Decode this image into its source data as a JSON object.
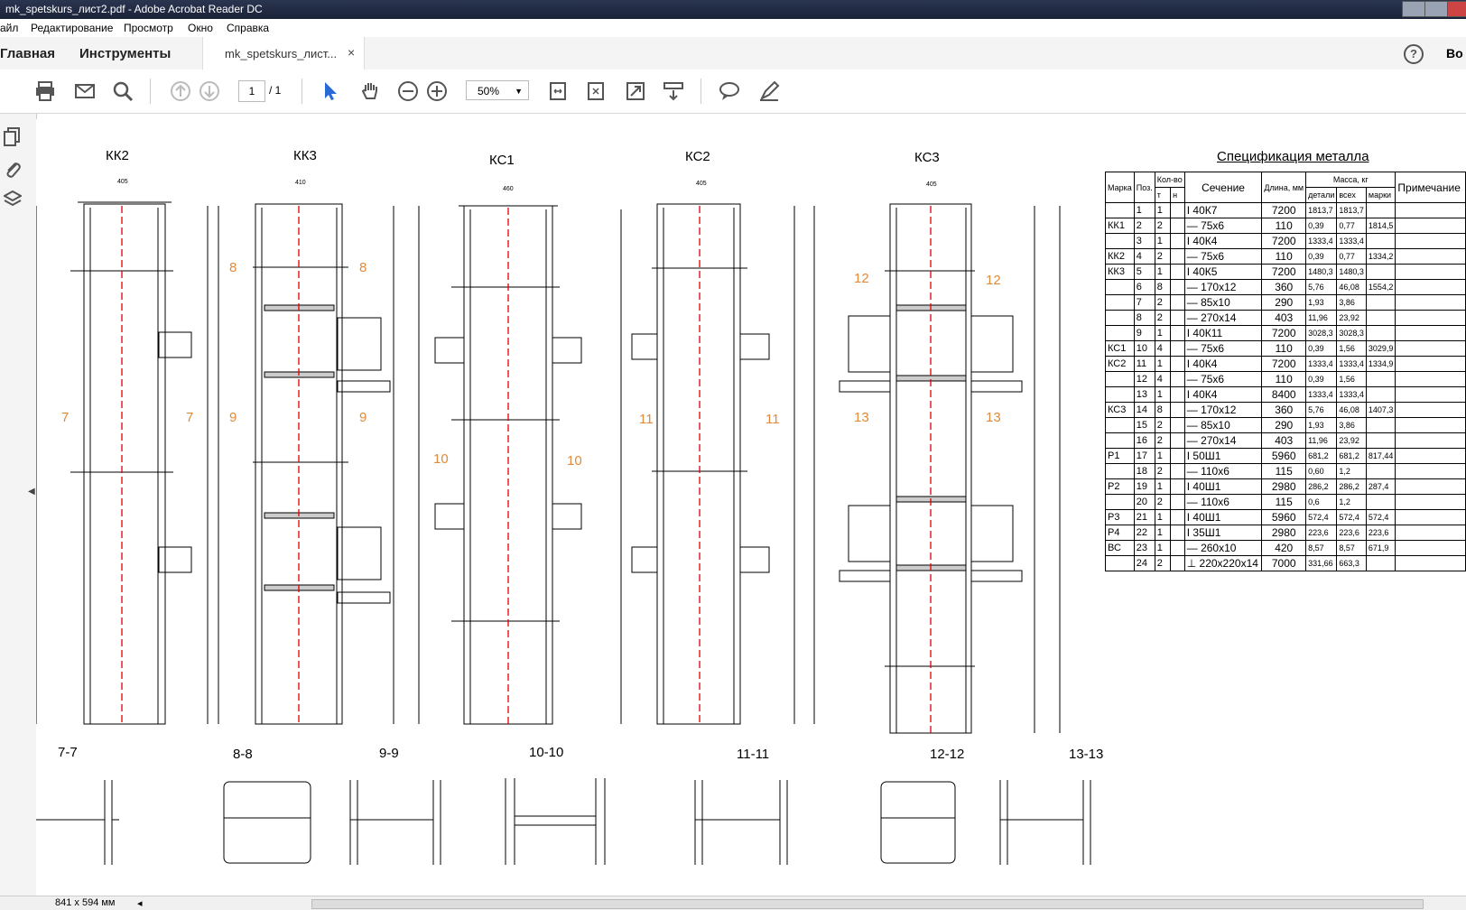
{
  "window": {
    "title": "mk_spetskurs_лист2.pdf - Adobe Acrobat Reader DC"
  },
  "menu": [
    "айл",
    "Редактирование",
    "Просмотр",
    "Окно",
    "Справка"
  ],
  "tabs": {
    "home": "Главная",
    "tools": "Инструменты",
    "doc": "mk_spetskurs_лист...",
    "close": "×",
    "help": "?",
    "right": "Во"
  },
  "toolbar": {
    "page_current": "1",
    "page_total": "/ 1",
    "zoom": "50%"
  },
  "status": {
    "size": "841 x 594 мм"
  },
  "drawing": {
    "columns": [
      {
        "name": "КК2",
        "w": "405"
      },
      {
        "name": "КК3",
        "w": "410"
      },
      {
        "name": "КС1",
        "w": "460"
      },
      {
        "name": "КС2",
        "w": "405"
      },
      {
        "name": "КС3",
        "w": "405"
      }
    ],
    "sections": [
      "7-7",
      "8-8",
      "9-9",
      "10-10",
      "11-11",
      "12-12",
      "13-13"
    ],
    "cut_marks": [
      "7",
      "8",
      "9",
      "10",
      "11",
      "12",
      "13"
    ]
  },
  "spec": {
    "title": "Спецификация металла",
    "headers": {
      "mark": "Марка",
      "pos": "Поз.",
      "qty": "Кол-во",
      "t": "т",
      "n": "н",
      "section": "Сечение",
      "length": "Длина, мм",
      "mass": "Масса, кг",
      "part": "детали",
      "all": "всех",
      "marks": "марки",
      "note": "Примечание"
    },
    "rows": [
      {
        "mark": "",
        "pos": "1",
        "q": "1",
        "sec": "I 40К7",
        "len": "7200",
        "p": "1813,7",
        "a": "1813,7",
        "m": ""
      },
      {
        "mark": "КК1",
        "pos": "2",
        "q": "2",
        "sec": "— 75x6",
        "len": "110",
        "p": "0,39",
        "a": "0,77",
        "m": "1814,5"
      },
      {
        "mark": "",
        "pos": "3",
        "q": "1",
        "sec": "I 40К4",
        "len": "7200",
        "p": "1333,4",
        "a": "1333,4",
        "m": ""
      },
      {
        "mark": "КК2",
        "pos": "4",
        "q": "2",
        "sec": "— 75x6",
        "len": "110",
        "p": "0,39",
        "a": "0,77",
        "m": "1334,2"
      },
      {
        "mark": "КК3",
        "pos": "5",
        "q": "1",
        "sec": "I 40К5",
        "len": "7200",
        "p": "1480,3",
        "a": "1480,3",
        "m": ""
      },
      {
        "mark": "",
        "pos": "6",
        "q": "8",
        "sec": "— 170x12",
        "len": "360",
        "p": "5,76",
        "a": "46,08",
        "m": "1554,2"
      },
      {
        "mark": "",
        "pos": "7",
        "q": "2",
        "sec": "— 85x10",
        "len": "290",
        "p": "1,93",
        "a": "3,86",
        "m": ""
      },
      {
        "mark": "",
        "pos": "8",
        "q": "2",
        "sec": "— 270x14",
        "len": "403",
        "p": "11,96",
        "a": "23,92",
        "m": ""
      },
      {
        "mark": "",
        "pos": "9",
        "q": "1",
        "sec": "I 40К11",
        "len": "7200",
        "p": "3028,3",
        "a": "3028,3",
        "m": ""
      },
      {
        "mark": "КС1",
        "pos": "10",
        "q": "4",
        "sec": "— 75x6",
        "len": "110",
        "p": "0,39",
        "a": "1,56",
        "m": "3029,9"
      },
      {
        "mark": "КС2",
        "pos": "11",
        "q": "1",
        "sec": "I 40К4",
        "len": "7200",
        "p": "1333,4",
        "a": "1333,4",
        "m": "1334,9"
      },
      {
        "mark": "",
        "pos": "12",
        "q": "4",
        "sec": "— 75x6",
        "len": "110",
        "p": "0,39",
        "a": "1,56",
        "m": ""
      },
      {
        "mark": "",
        "pos": "13",
        "q": "1",
        "sec": "I 40К4",
        "len": "8400",
        "p": "1333,4",
        "a": "1333,4",
        "m": ""
      },
      {
        "mark": "КС3",
        "pos": "14",
        "q": "8",
        "sec": "— 170x12",
        "len": "360",
        "p": "5,76",
        "a": "46,08",
        "m": "1407,3"
      },
      {
        "mark": "",
        "pos": "15",
        "q": "2",
        "sec": "— 85x10",
        "len": "290",
        "p": "1,93",
        "a": "3,86",
        "m": ""
      },
      {
        "mark": "",
        "pos": "16",
        "q": "2",
        "sec": "— 270x14",
        "len": "403",
        "p": "11,96",
        "a": "23,92",
        "m": ""
      },
      {
        "mark": "Р1",
        "pos": "17",
        "q": "1",
        "sec": "I 50Ш1",
        "len": "5960",
        "p": "681,2",
        "a": "681,2",
        "m": "817,44"
      },
      {
        "mark": "",
        "pos": "18",
        "q": "2",
        "sec": "— 110x6",
        "len": "115",
        "p": "0,60",
        "a": "1,2",
        "m": ""
      },
      {
        "mark": "Р2",
        "pos": "19",
        "q": "1",
        "sec": "I 40Ш1",
        "len": "2980",
        "p": "286,2",
        "a": "286,2",
        "m": "287,4"
      },
      {
        "mark": "",
        "pos": "20",
        "q": "2",
        "sec": "— 110x6",
        "len": "115",
        "p": "0,6",
        "a": "1,2",
        "m": ""
      },
      {
        "mark": "Р3",
        "pos": "21",
        "q": "1",
        "sec": "I 40Ш1",
        "len": "5960",
        "p": "572,4",
        "a": "572,4",
        "m": "572,4"
      },
      {
        "mark": "Р4",
        "pos": "22",
        "q": "1",
        "sec": "I 35Ш1",
        "len": "2980",
        "p": "223,6",
        "a": "223,6",
        "m": "223,6"
      },
      {
        "mark": "ВС",
        "pos": "23",
        "q": "1",
        "sec": "— 260x10",
        "len": "420",
        "p": "8,57",
        "a": "8,57",
        "m": "671,9"
      },
      {
        "mark": "",
        "pos": "24",
        "q": "2",
        "sec": "⊥ 220x220x14",
        "len": "7000",
        "p": "331,66",
        "a": "663,3",
        "m": ""
      }
    ]
  }
}
